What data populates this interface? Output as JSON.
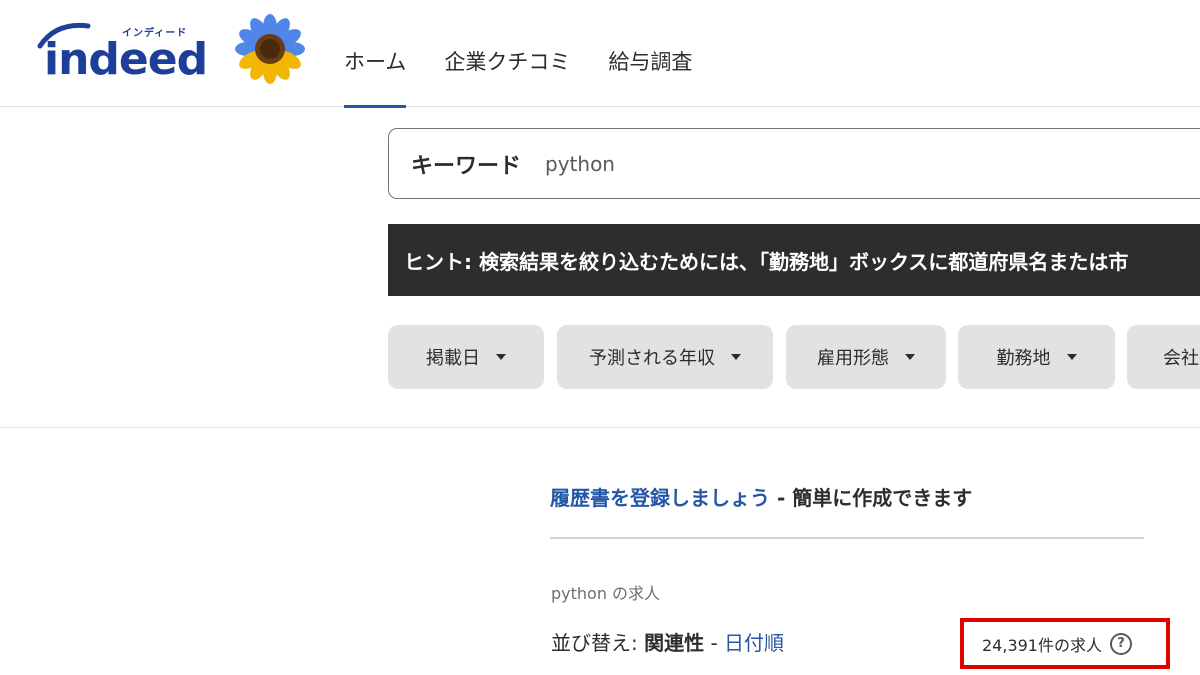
{
  "header": {
    "logo_word": "indeed",
    "logo_kana": "インディード",
    "nav": [
      {
        "label": "ホーム",
        "active": true
      },
      {
        "label": "企業クチコミ",
        "active": false
      },
      {
        "label": "給与調査",
        "active": false
      }
    ]
  },
  "search": {
    "label": "キーワード",
    "value": "python"
  },
  "hint": {
    "text": "ヒント: 検索結果を絞り込むためには、「勤務地」ボックスに都道府県名または市"
  },
  "filters": [
    {
      "label": "掲載日"
    },
    {
      "label": "予測される年収"
    },
    {
      "label": "雇用形態"
    },
    {
      "label": "勤務地"
    },
    {
      "label": "会社"
    }
  ],
  "promo": {
    "link_text": "履歴書を登録しましょう",
    "rest_text": " - 簡単に作成できます"
  },
  "results": {
    "heading": "python の求人",
    "sort_label": "並び替え: ",
    "sort_current": "関連性",
    "sort_separator": " - ",
    "sort_date": "日付順",
    "count_text": "24,391件の求人",
    "help_glyph": "?"
  },
  "colors": {
    "brand_blue": "#1d3f99",
    "link_blue": "#2557a7",
    "highlight_red": "#e00000",
    "hint_bg": "#2d2d2d",
    "chip_bg": "#e4e2e0"
  }
}
